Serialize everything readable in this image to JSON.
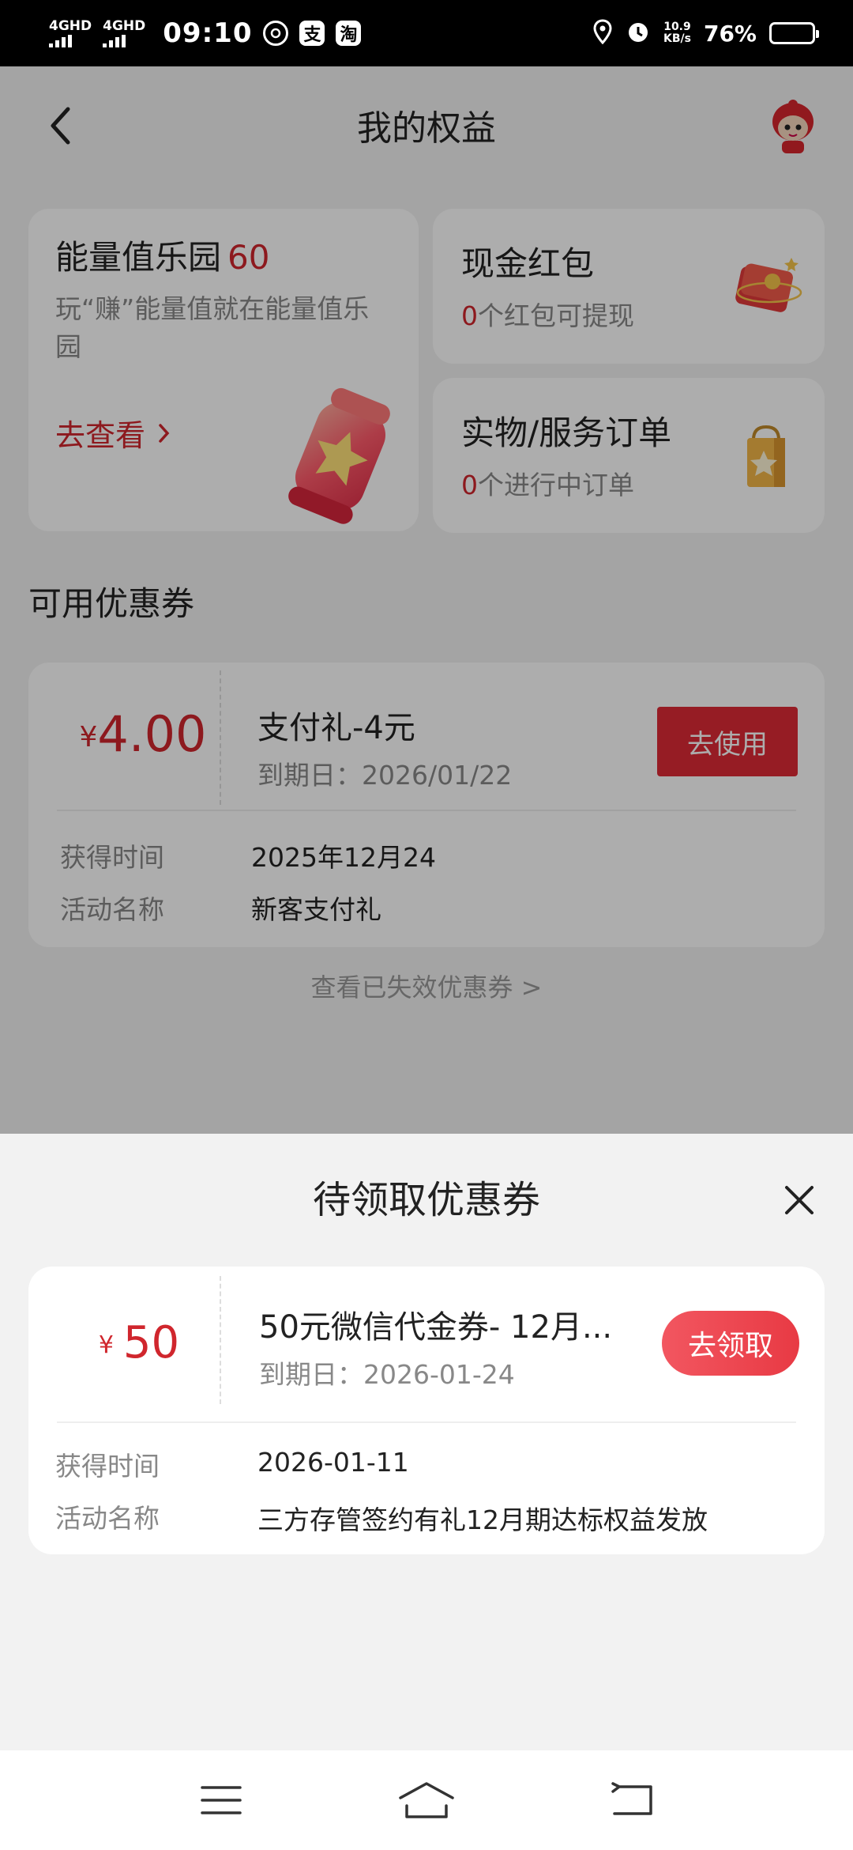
{
  "status_bar": {
    "network1": "4GHD",
    "network2": "4GHD",
    "time": "09:10",
    "app_icons": [
      "支",
      "淘"
    ],
    "speed_value": "10.9",
    "speed_unit": "KB/s",
    "battery": "76%",
    "battery_level": 0.76
  },
  "header": {
    "title": "我的权益"
  },
  "energy": {
    "title": "能量值乐园",
    "value": "60",
    "desc": "玩“赚”能量值就在能量值乐园",
    "link": "去查看"
  },
  "cash": {
    "title": "现金红包",
    "count": "0",
    "suffix": "个红包可提现"
  },
  "orders": {
    "title": "实物/服务订单",
    "count": "0",
    "suffix": "个进行中订单"
  },
  "available": {
    "section_title": "可用优惠券",
    "coupon": {
      "currency": "¥",
      "amount": "4.00",
      "name": "支付礼-4元",
      "expiry": "到期日：2026/01/22",
      "button": "去使用",
      "obtained_label": "获得时间",
      "obtained_value": "2025年12月24",
      "activity_label": "活动名称",
      "activity_value": "新客支付礼"
    },
    "expired_link": "查看已失效优惠券 >"
  },
  "sheet": {
    "title": "待领取优惠券",
    "coupon": {
      "currency": "¥",
      "amount": "50",
      "name": "50元微信代金券- 12月...",
      "expiry": "到期日：2026-01-24",
      "button": "去领取",
      "obtained_label": "获得时间",
      "obtained_value": "2026-01-11",
      "activity_label": "活动名称",
      "activity_value": "三方存管签约有礼12月期达标权益发放"
    }
  },
  "colors": {
    "accent_red": "#d0262d",
    "button_red": "#dd2a35",
    "pill_gradient_start": "#f25660",
    "pill_gradient_end": "#e83a44"
  },
  "icons": [
    "back-arrow-icon",
    "mascot-avatar-icon",
    "chevron-right-icon",
    "energy-jar-icon",
    "red-envelope-icon",
    "shopping-bag-icon",
    "close-icon",
    "menu-icon",
    "home-icon",
    "back-icon"
  ]
}
